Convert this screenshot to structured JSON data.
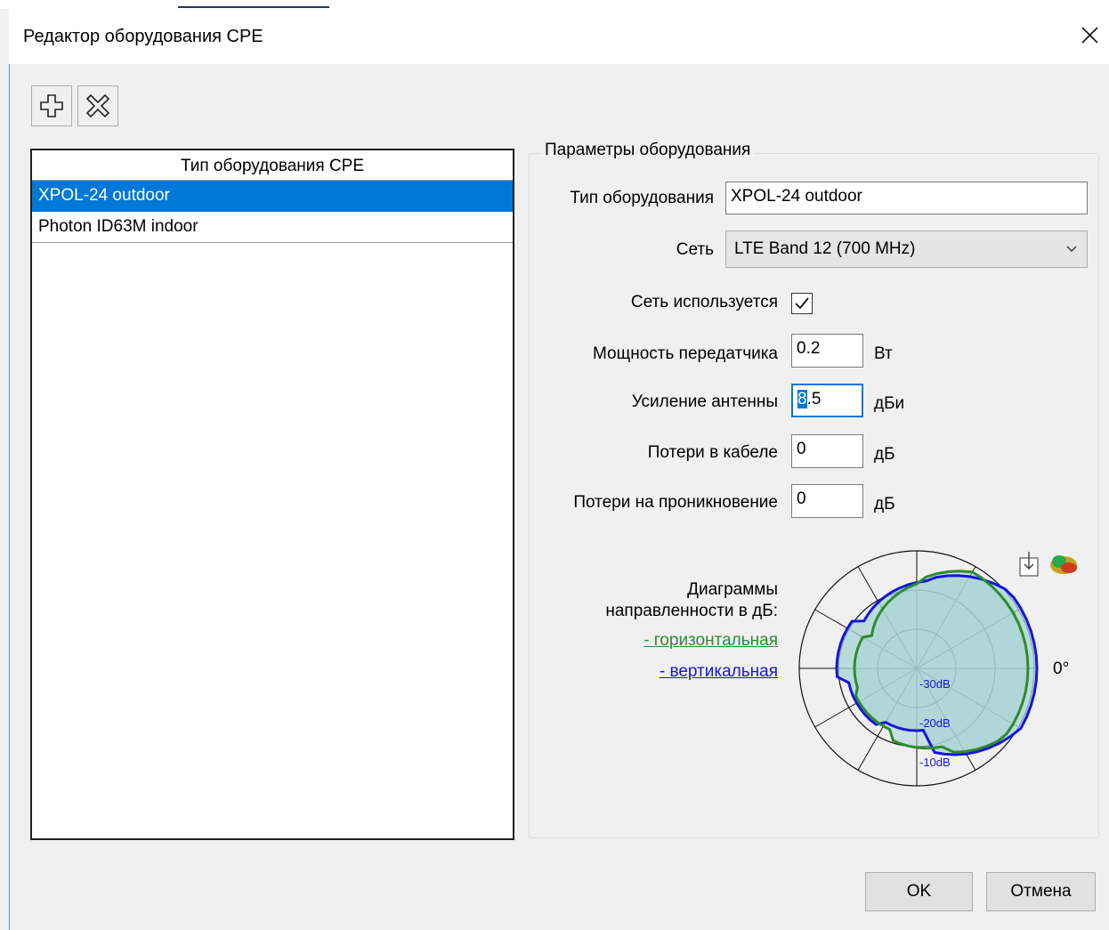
{
  "window": {
    "title": "Редактор оборудования CPE"
  },
  "list": {
    "header": "Тип оборудования CPE",
    "items": [
      "XPOL-24 outdoor",
      "Photon ID63M indoor"
    ],
    "selected_index": 0
  },
  "params": {
    "group_label": "Параметры оборудования",
    "equipment_type_label": "Тип оборудования",
    "equipment_type_value": "XPOL-24 outdoor",
    "network_label": "Сеть",
    "network_value": "LTE Band 12 (700 MHz)",
    "network_used_label": "Сеть используется",
    "network_used_checked": true,
    "tx_power_label": "Мощность передатчика",
    "tx_power_value": "0.2",
    "tx_power_unit": "Вт",
    "antenna_gain_label": "Усиление антенны",
    "antenna_gain_sel": "8",
    "antenna_gain_rest": ".5",
    "antenna_gain_unit": "дБи",
    "cable_loss_label": "Потери в кабеле",
    "cable_loss_value": "0",
    "cable_loss_unit": "дБ",
    "penetration_loss_label": "Потери на проникновение",
    "penetration_loss_value": "0",
    "penetration_loss_unit": "дБ"
  },
  "pattern": {
    "title_line1": "Диаграммы",
    "title_line2": "направленности в дБ:",
    "horizontal_link": "- горизонтальная",
    "vertical_link": "- вертикальная",
    "angle_label": "0°",
    "ring_labels": [
      "-30dB",
      "-20dB",
      "-10dB"
    ],
    "horizontal_color": "#2e8b2e",
    "vertical_color": "#1515e0",
    "fill_color": "#a8d4d4"
  },
  "buttons": {
    "ok": "OK",
    "cancel": "Отмена"
  },
  "icons": {
    "add": "plus-icon",
    "delete": "delete-icon",
    "download": "download-icon",
    "view3d": "3d-pattern-icon",
    "close": "close-icon"
  }
}
